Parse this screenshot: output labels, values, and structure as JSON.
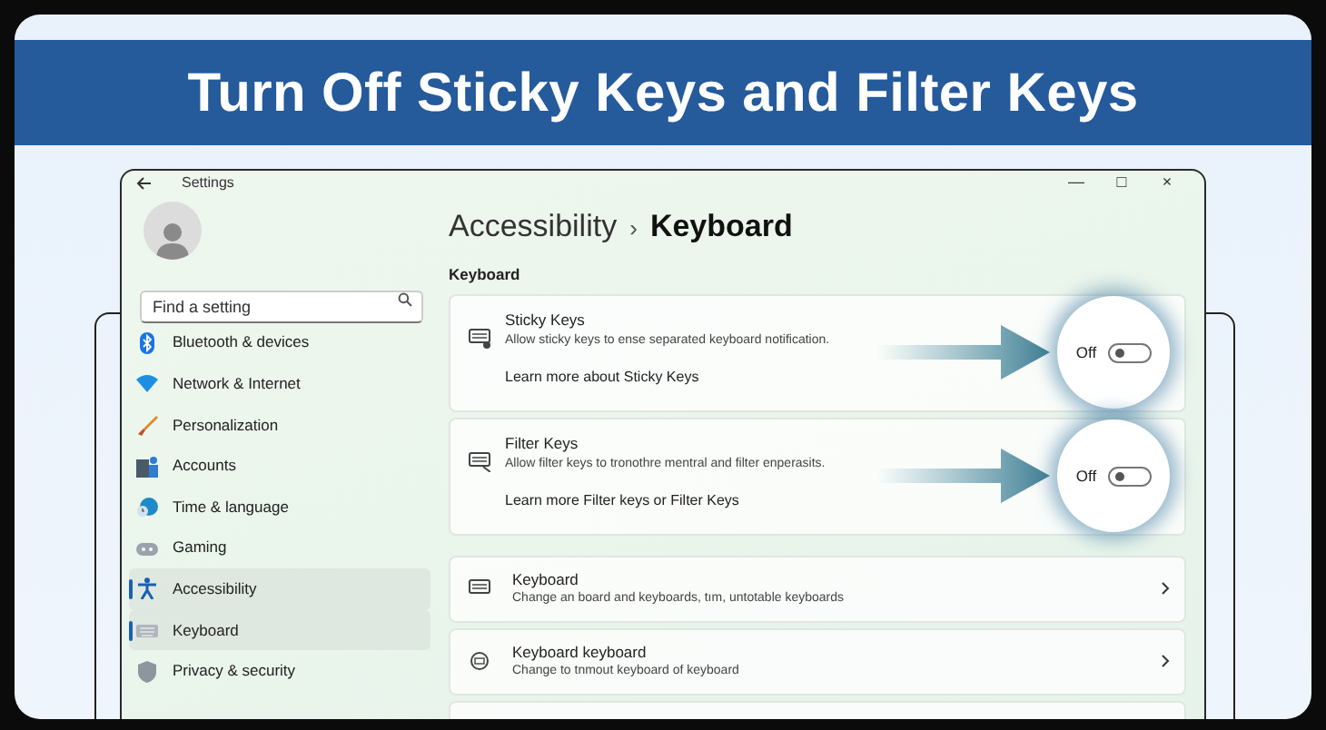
{
  "banner": {
    "title": "Turn Off Sticky Keys and Filter Keys"
  },
  "window": {
    "title": "Settings",
    "controls": [
      "—",
      "□",
      "×"
    ]
  },
  "search": {
    "placeholder": "Find a setting"
  },
  "sidebar": {
    "items": [
      {
        "label": "Bluetooth & devices",
        "selected": false
      },
      {
        "label": "Network & Internet",
        "selected": false
      },
      {
        "label": "Personalization",
        "selected": false
      },
      {
        "label": "Accounts",
        "selected": false
      },
      {
        "label": "Time & language",
        "selected": false
      },
      {
        "label": "Gaming",
        "selected": false
      },
      {
        "label": "Accessibility",
        "selected": true
      },
      {
        "label": "Keyboard",
        "selected": true
      },
      {
        "label": "Privacy & security",
        "selected": false
      }
    ]
  },
  "breadcrumb": {
    "parent": "Accessibility",
    "separator": "›",
    "current": "Keyboard"
  },
  "section_label": "Keyboard",
  "toggle_cards": [
    {
      "title": "Sticky Keys",
      "description": "Allow sticky keys to ense separated keyboard notification.",
      "link": "Learn more about Sticky Keys",
      "toggle_label": "Off",
      "on": false
    },
    {
      "title": "Filter Keys",
      "description": "Allow filter keys to tronothre mentral and filter enperasits.",
      "link": "Learn more Filter keys or Filter Keys",
      "toggle_label": "Off",
      "on": false
    }
  ],
  "nav_rows": [
    {
      "title": "Keyboard",
      "description": "Change an board and keyboards, tım, untotable keyboards"
    },
    {
      "title": "Keyboard keyboard",
      "description": "Change to tnmout keyboard of keyboard"
    }
  ]
}
